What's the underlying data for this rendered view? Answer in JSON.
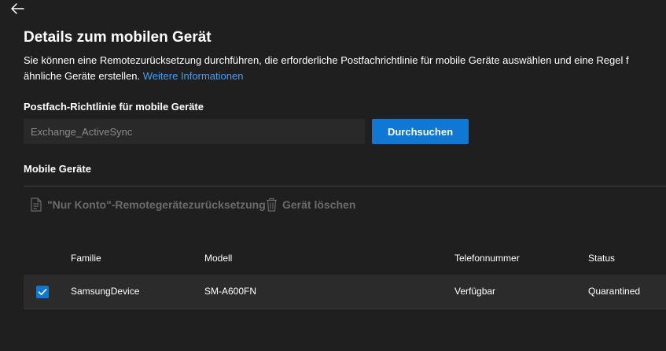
{
  "header": {
    "back_icon": "back-arrow-icon",
    "title": "Details zum mobilen Gerät",
    "description_line1": "Sie können eine Remotezurücksetzung durchführen, die erforderliche Postfachrichtlinie für mobile Geräte auswählen und eine Regel f",
    "description_line2": "ähnliche Geräte erstellen.",
    "more_info_link": "Weitere Informationen"
  },
  "policy": {
    "label": "Postfach-Richtlinie für mobile Geräte",
    "value": "Exchange_ActiveSync",
    "browse_button": "Durchsuchen"
  },
  "devices": {
    "label": "Mobile Geräte",
    "commands": {
      "reset_label": "\"Nur Konto\"-Remotegerätezurücksetzung",
      "reset_icon": "document-reset-icon",
      "delete_label": "Gerät löschen",
      "delete_icon": "trash-icon"
    },
    "columns": [
      "Familie",
      "Modell",
      "Telefonnummer",
      "Status"
    ],
    "rows": [
      {
        "selected": true,
        "family": "SamsungDevice",
        "model": "SM-A600FN",
        "phone": "Verfügbar",
        "status": "Quarantined"
      }
    ]
  },
  "colors": {
    "background": "#1f1f1f",
    "accent": "#0f78d4",
    "link": "#479ef5",
    "disabled": "#6b6b6b"
  }
}
